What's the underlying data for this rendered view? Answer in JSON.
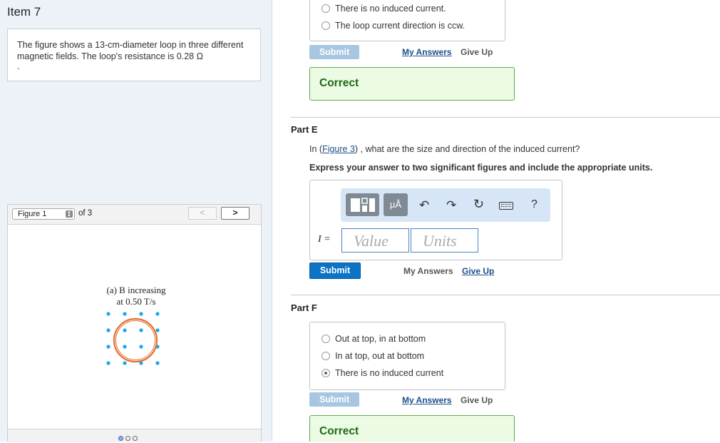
{
  "item_title": "Item 7",
  "description": {
    "text": "The figure shows a 13-cm-diameter loop in three different magnetic fields. The loop's resistance is 0.28 Ω",
    "trailing": "."
  },
  "figure": {
    "select_value": "Figure 1",
    "of_total": "of 3",
    "prev_glyph": "<",
    "next_glyph": ">",
    "caption_line1": "(a) B increasing",
    "caption_line2": "at 0.50 T/s",
    "page_count": 3,
    "active_page": 1,
    "dot_color": "#1aa7e6",
    "loop_color": "#e46d2d"
  },
  "part_d": {
    "options": [
      {
        "label": "There is no induced current.",
        "checked": false
      },
      {
        "label": "The loop current direction is ccw.",
        "checked": false
      }
    ],
    "submit_label": "Submit",
    "my_answers_label": "My Answers",
    "give_up_label": "Give Up",
    "correct_label": "Correct"
  },
  "part_e": {
    "label": "Part E",
    "question_prefix": "In (",
    "figure_link": "Figure 3",
    "question_suffix": ") , what are the size and direction of the induced current?",
    "instruction": "Express your answer to two significant figures and include the appropriate units.",
    "toolbar": {
      "unit_button": "μÅ",
      "help": "?"
    },
    "variable_label": "I =",
    "value_placeholder": "Value",
    "units_placeholder": "Units",
    "submit_label": "Submit",
    "my_answers_label": "My Answers",
    "give_up_label": "Give Up"
  },
  "part_f": {
    "label": "Part F",
    "options": [
      {
        "label": "Out at top, in at bottom",
        "checked": false
      },
      {
        "label": "In at top, out at bottom",
        "checked": false
      },
      {
        "label": "There is no induced current",
        "checked": true
      }
    ],
    "submit_label": "Submit",
    "my_answers_label": "My Answers",
    "give_up_label": "Give Up",
    "correct_label": "Correct"
  }
}
